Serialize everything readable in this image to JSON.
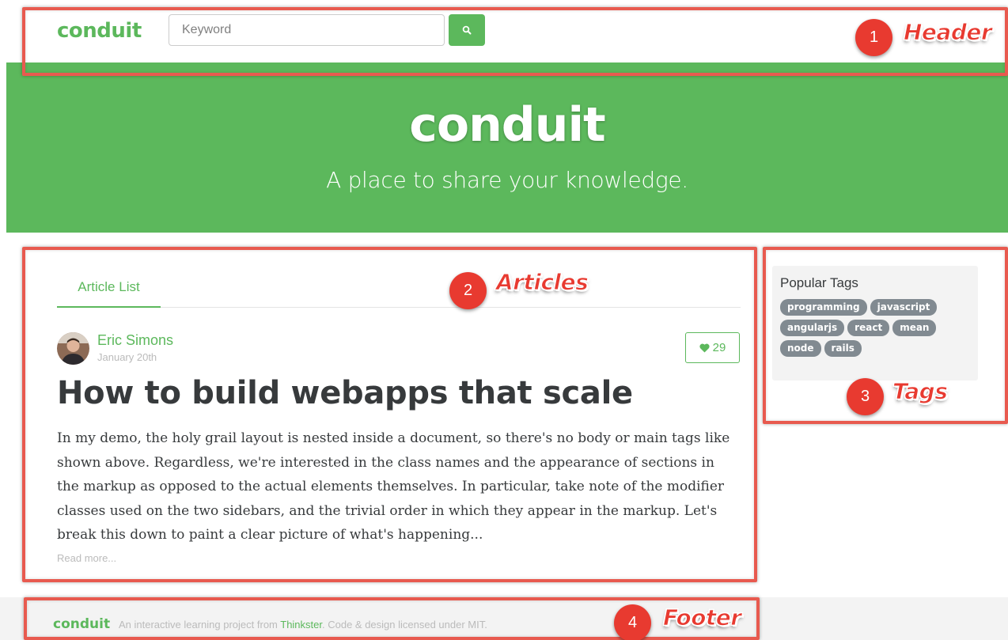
{
  "header": {
    "brand": "conduit",
    "search_placeholder": "Keyword"
  },
  "banner": {
    "title": "conduit",
    "subtitle": "A place to share your knowledge."
  },
  "articles": {
    "tab_label": "Article List",
    "article": {
      "author": "Eric Simons",
      "date": "January 20th",
      "likes": "29",
      "title": "How to build webapps that scale",
      "body": "In my demo, the holy grail layout is nested inside a document, so there's no body or main tags like shown above. Regardless, we're interested in the class names and the appearance of sections in the markup as opposed to the actual elements themselves. In particular, take note of the modifier classes used on the two sidebars, and the trivial order in which they appear in the markup. Let's break this down to paint a clear picture of what's happening...",
      "read_more": "Read more..."
    }
  },
  "tags": {
    "title": "Popular Tags",
    "items": [
      "programming",
      "javascript",
      "angularjs",
      "react",
      "mean",
      "node",
      "rails"
    ]
  },
  "footer": {
    "brand": "conduit",
    "text_before": "An interactive learning project from ",
    "link": "Thinkster",
    "text_after": ". Code & design licensed under MIT."
  },
  "annotations": [
    {
      "number": "1",
      "label": "Header"
    },
    {
      "number": "2",
      "label": "Articles"
    },
    {
      "number": "3",
      "label": "Tags"
    },
    {
      "number": "4",
      "label": "Footer"
    }
  ],
  "colors": {
    "brand_green": "#5cb85c",
    "annotation_red": "#e85a4f",
    "tag_gray": "#818a91"
  }
}
